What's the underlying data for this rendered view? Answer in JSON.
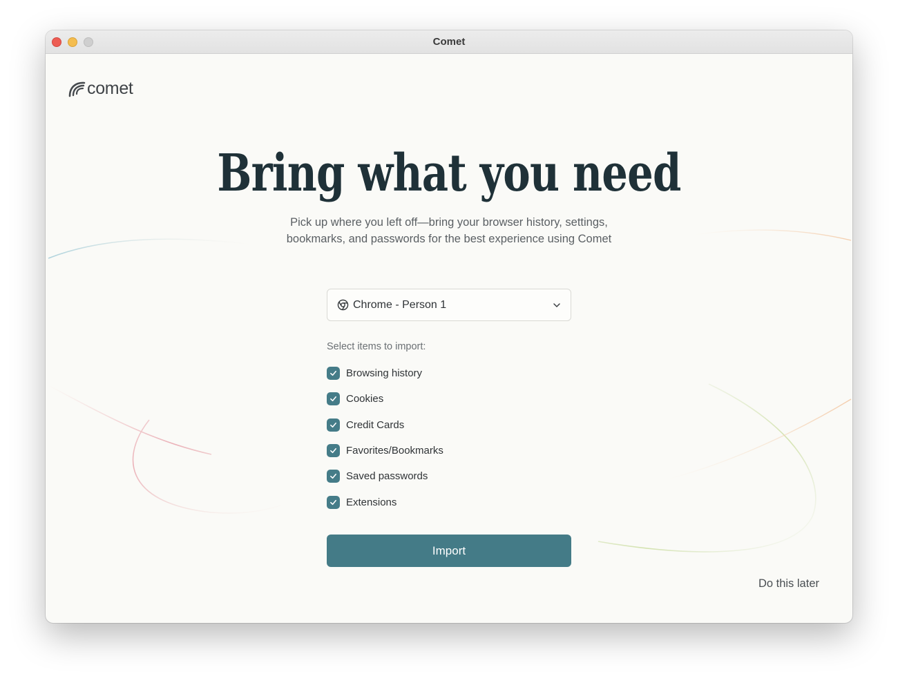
{
  "window": {
    "title": "Comet"
  },
  "logo": {
    "text": "comet"
  },
  "hero": {
    "headline": "Bring what you need",
    "subtitle_line1": "Pick up where you left off—bring your browser history, settings,",
    "subtitle_line2": "bookmarks, and passwords for the best experience using Comet"
  },
  "profile_select": {
    "selected": "Chrome - Person 1",
    "icon": "chrome-icon"
  },
  "import_items": {
    "label": "Select items to import:",
    "items": [
      {
        "label": "Browsing history",
        "checked": true
      },
      {
        "label": "Cookies",
        "checked": true
      },
      {
        "label": "Credit Cards",
        "checked": true
      },
      {
        "label": "Favorites/Bookmarks",
        "checked": true
      },
      {
        "label": "Saved passwords",
        "checked": true
      },
      {
        "label": "Extensions",
        "checked": true
      }
    ]
  },
  "actions": {
    "import_label": "Import",
    "later_label": "Do this later"
  },
  "colors": {
    "accent": "#447b87",
    "heading": "#1f3138",
    "background": "#fafaf7"
  }
}
